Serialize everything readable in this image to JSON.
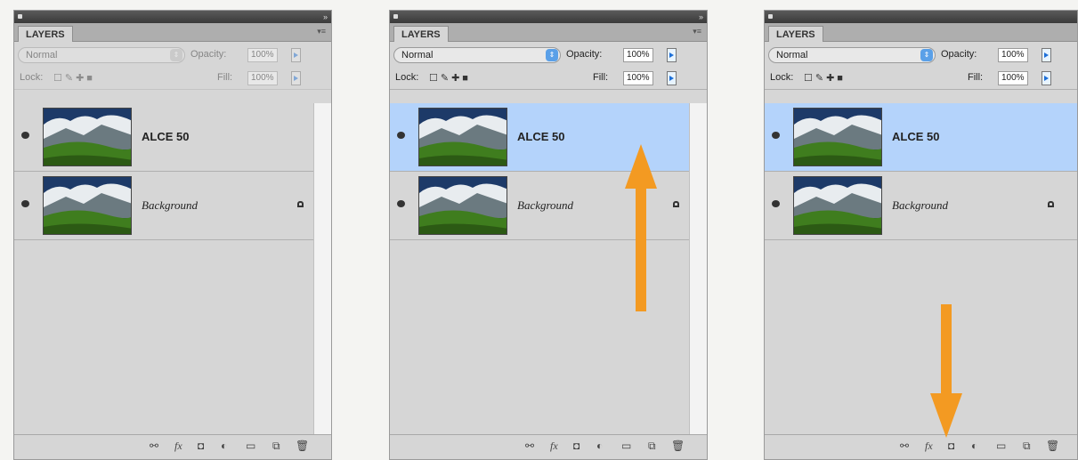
{
  "panels": [
    {
      "tab_label": "LAYERS",
      "blend_mode": "Normal",
      "opacity_label": "Opacity:",
      "opacity_value": "100%",
      "lock_label": "Lock:",
      "fill_label": "Fill:",
      "fill_value": "100%",
      "disabled": true,
      "selected_layer": null,
      "layers": [
        {
          "name": "ALCE 50",
          "style": "bold",
          "locked": false
        },
        {
          "name": "Background",
          "style": "italic",
          "locked": true
        }
      ]
    },
    {
      "tab_label": "LAYERS",
      "blend_mode": "Normal",
      "opacity_label": "Opacity:",
      "opacity_value": "100%",
      "lock_label": "Lock:",
      "fill_label": "Fill:",
      "fill_value": "100%",
      "disabled": false,
      "selected_layer": 0,
      "layers": [
        {
          "name": "ALCE 50",
          "style": "bold",
          "locked": false
        },
        {
          "name": "Background",
          "style": "italic",
          "locked": true
        }
      ]
    },
    {
      "tab_label": "LAYERS",
      "blend_mode": "Normal",
      "opacity_label": "Opacity:",
      "opacity_value": "100%",
      "lock_label": "Lock:",
      "fill_label": "Fill:",
      "fill_value": "100%",
      "disabled": false,
      "selected_layer": 0,
      "layers": [
        {
          "name": "ALCE 50",
          "style": "bold",
          "locked": false
        },
        {
          "name": "Background",
          "style": "italic",
          "locked": true
        }
      ]
    }
  ],
  "footer_icons": [
    "link-layers-icon",
    "fx-icon",
    "add-mask-icon",
    "adjustment-layer-icon",
    "new-group-icon",
    "new-layer-icon",
    "trash-icon"
  ],
  "colors": {
    "selection": "#b4d3fb",
    "arrow": "#f39a22",
    "panel_bg": "#d6d6d6"
  },
  "annotations": [
    {
      "panel": 1,
      "icon": "arrow-up-icon"
    },
    {
      "panel": 2,
      "icon": "arrow-down-icon"
    }
  ]
}
